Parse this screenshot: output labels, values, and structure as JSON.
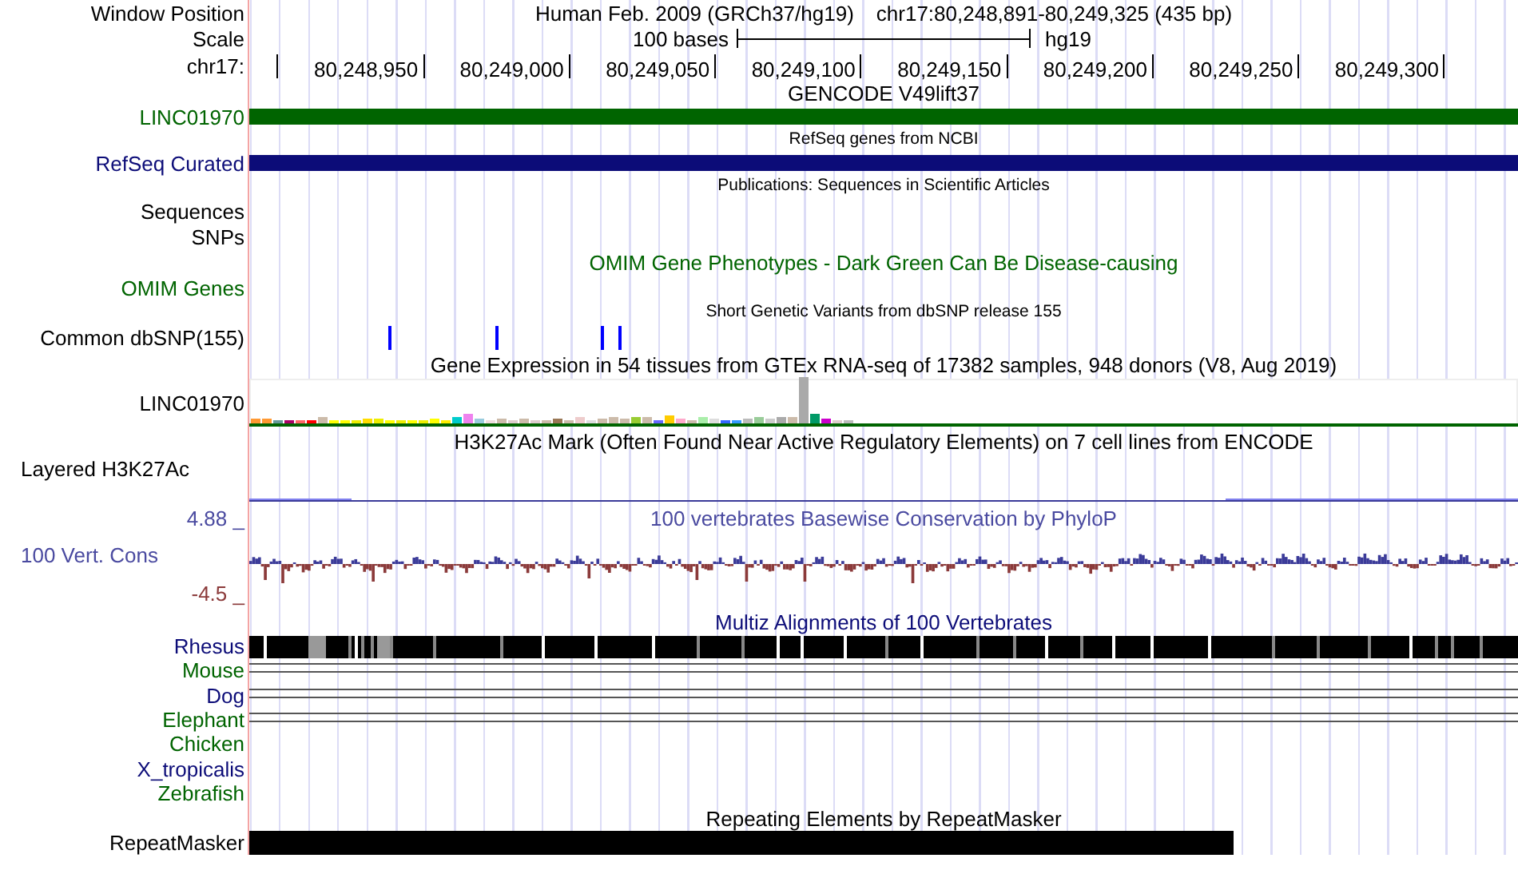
{
  "header": {
    "position_label": "Window Position",
    "assembly": "Human Feb. 2009 (GRCh37/hg19)",
    "position": "chr17:80,248,891-80,249,325 (435 bp)",
    "scale_label": "Scale",
    "scale_text": "100 bases",
    "scale_db": "hg19",
    "ruler_label": "chr17:",
    "ruler_ticks": [
      "80,248,950",
      "80,249,000",
      "80,249,050",
      "80,249,100",
      "80,249,150",
      "80,249,200",
      "80,249,250",
      "80,249,300"
    ]
  },
  "tracks": [
    {
      "kind": "gene",
      "title": "GENCODE V49lift37",
      "small_title": false,
      "colored_title": false,
      "label": "LINC01970",
      "color": "#006400"
    },
    {
      "kind": "gene",
      "title": "RefSeq genes from NCBI",
      "small_title": true,
      "colored_title": false,
      "label": "RefSeq Curated",
      "color": "#0c0c78"
    },
    {
      "kind": "empty",
      "title": "Publications: Sequences in Scientific Articles",
      "small_title": true,
      "label": "Sequences",
      "color": "#000000"
    },
    {
      "kind": "empty",
      "label": "SNPs",
      "color": "#000000"
    },
    {
      "kind": "empty",
      "title": "OMIM Gene Phenotypes - Dark Green Can Be Disease-causing",
      "small_title": false,
      "colored_title": true,
      "label": "OMIM Genes",
      "color": "#006400"
    },
    {
      "kind": "snp",
      "title": "Short Genetic Variants from dbSNP release 155",
      "small_title": true,
      "label": "Common dbSNP(155)",
      "color": "#000000"
    },
    {
      "kind": "gtex",
      "title": "Gene Expression in 54 tissues from GTEx RNA-seq of 17382 samples, 948 donors (V8, Aug 2019)",
      "small_title": false,
      "label": "LINC01970",
      "color": "#000000"
    },
    {
      "kind": "signal",
      "title": "H3K27Ac Mark (Often Found Near Active Regulatory Elements) on 7 cell lines from ENCODE",
      "small_title": false,
      "label": "Layered H3K27Ac",
      "color": "#000000"
    },
    {
      "kind": "phylop",
      "title": "100 vertebrates Basewise Conservation by PhyloP",
      "label": "100 Vert. Cons",
      "color": "#4a4aa0",
      "max_label": "4.88 _",
      "min_label": {
        "text": "-4.5 _",
        "color": "#8b3a3a"
      }
    },
    {
      "kind": "multiz",
      "title": "Multiz Alignments of 100 Vertebrates",
      "small_title": false,
      "colored_title": true,
      "color": "#0c0c78",
      "species": [
        {
          "label": "Rhesus",
          "color": "#0c0c78",
          "kind": "blocks"
        },
        {
          "label": "Mouse",
          "color": "#006400",
          "kind": "lines"
        },
        {
          "label": "Dog",
          "color": "#0c0c78",
          "kind": "lines"
        },
        {
          "label": "Elephant",
          "color": "#006400",
          "kind": "lines"
        },
        {
          "label": "Chicken",
          "color": "#006400",
          "kind": "none"
        },
        {
          "label": "X_tropicalis",
          "color": "#0c0c78",
          "kind": "none"
        },
        {
          "label": "Zebrafish",
          "color": "#006400",
          "kind": "none"
        }
      ]
    },
    {
      "kind": "repeat",
      "title": "Repeating Elements by RepeatMasker",
      "small_title": false,
      "label": "RepeatMasker",
      "color": "#000000"
    }
  ]
}
